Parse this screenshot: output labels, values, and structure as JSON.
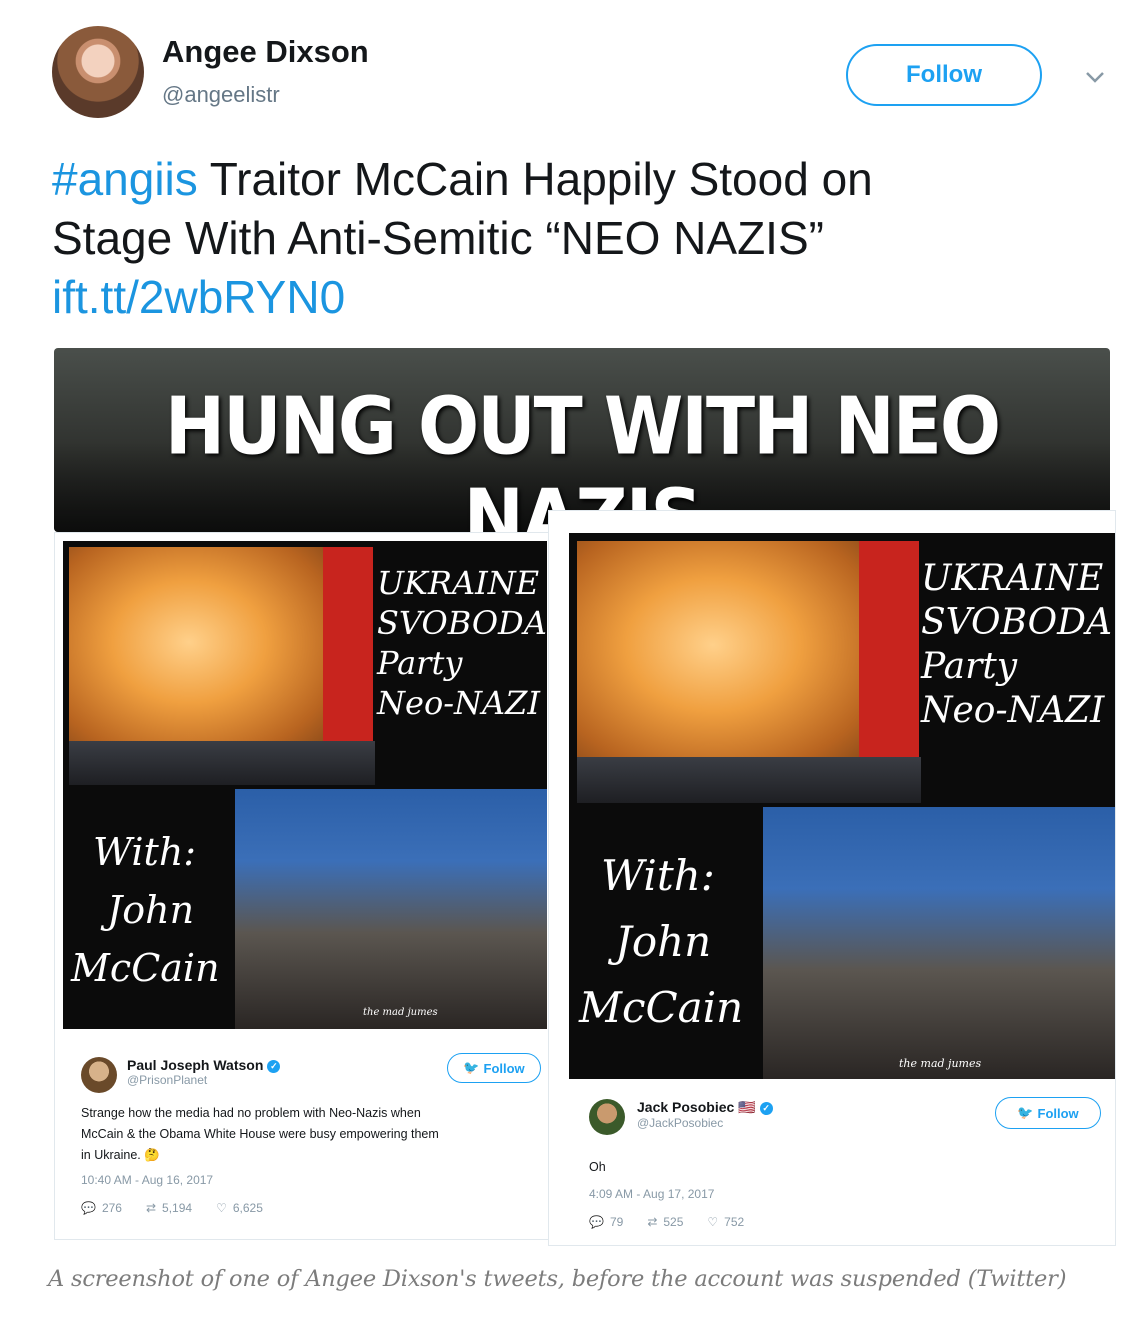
{
  "tweet": {
    "author_name": "Angee Dixson",
    "author_handle": "@angeelistr",
    "follow_label": "Follow",
    "hashtag": "#angiis",
    "text_line1": " Traitor McCain Happily Stood on",
    "text_line2": "Stage With Anti-Semitic “NEO NAZIS”",
    "link": "ift.tt/2wbRYN0"
  },
  "media": {
    "banner_title": "HUNG OUT WITH NEO NAZIS",
    "meme_lines": [
      "UKRAINE",
      "SVOBODA",
      "Party",
      "Neo-NAZI"
    ],
    "meme_with": [
      "With:",
      "John",
      "McCain"
    ],
    "meme_watermark": "the mad jumes"
  },
  "embedded_left": {
    "name": "Paul Joseph Watson",
    "handle": "@PrisonPlanet",
    "follow_label": "Follow",
    "text_line1": "Strange how the media had no problem with Neo-Nazis when",
    "text_line2": "McCain & the Obama White House were busy empowering them",
    "text_line3": "in Ukraine. 🤔",
    "time": "10:40 AM - Aug 16, 2017",
    "replies": "276",
    "retweets": "5,194",
    "likes": "6,625"
  },
  "embedded_right": {
    "name": "Jack Posobiec",
    "flag": "🇺🇸",
    "handle": "@JackPosobiec",
    "follow_label": "Follow",
    "text": "Oh",
    "time": "4:09 AM - Aug 17, 2017",
    "replies": "79",
    "retweets": "525",
    "likes": "752"
  },
  "caption": "A screenshot of one of Angee Dixson's tweets, before the account was suspended (Twitter)",
  "colors": {
    "link_blue": "#1b95e0",
    "follow_blue": "#1da1f2",
    "caption_gray": "#7c7c7c"
  }
}
